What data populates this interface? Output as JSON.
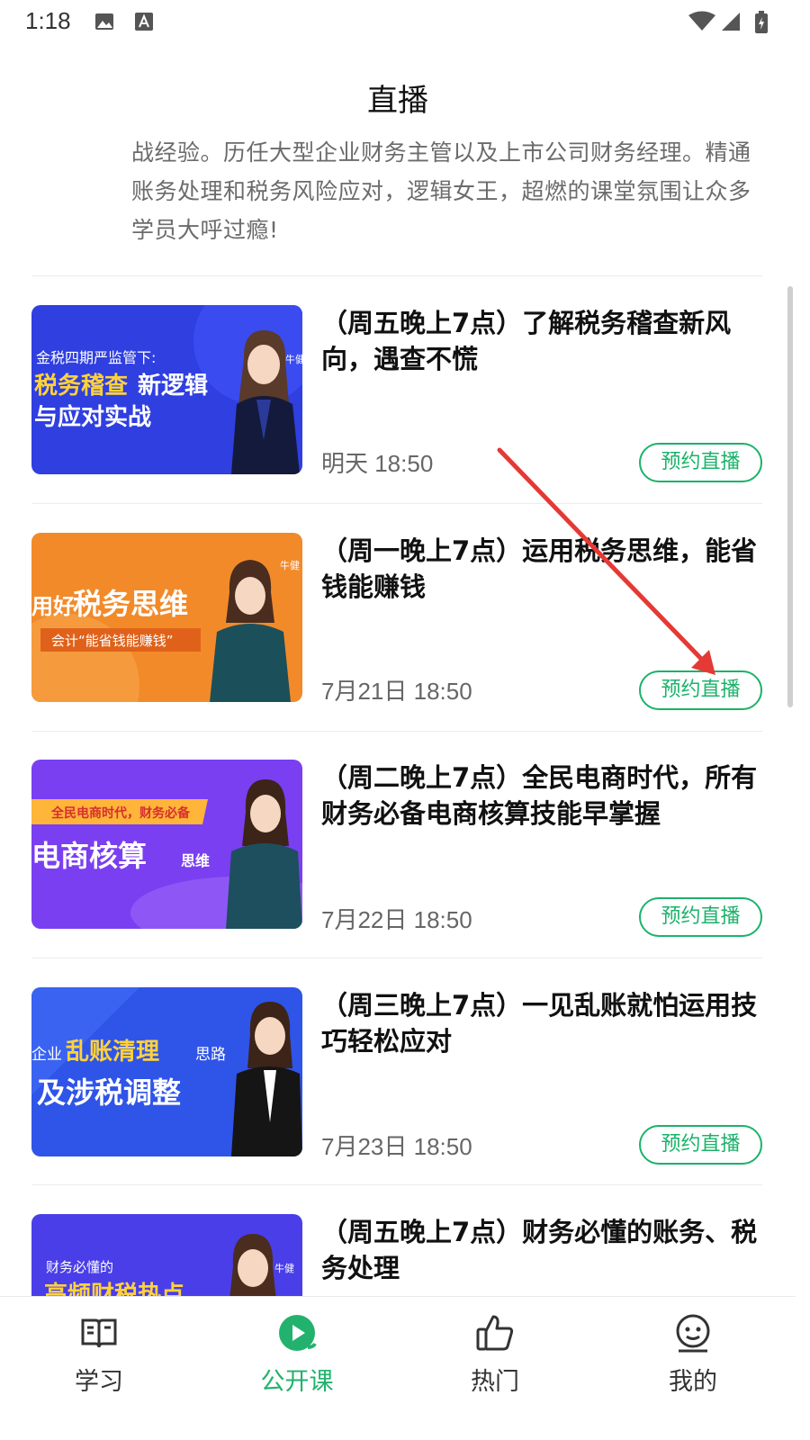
{
  "status": {
    "time": "1:18"
  },
  "header": {
    "title": "直播"
  },
  "intro": "战经验。历任大型企业财务主管以及上市公司财务经理。精通账务处理和税务风险应对，逻辑女王，超燃的课堂氛围让众多学员大呼过瘾!",
  "list": [
    {
      "title": "（周五晚上7点）了解税务稽查新风向，遇查不慌",
      "time": "明天 18:50",
      "button": "预约直播",
      "thumb": {
        "line1": "金税四期严监管下:",
        "line2a": "税务稽查",
        "line2b": "新逻辑",
        "line3": "与应对实战",
        "tag": "牛健",
        "bg": "#2f3fe0"
      }
    },
    {
      "title": "（周一晚上7点）运用税务思维，能省钱能赚钱",
      "time": "7月21日 18:50",
      "button": "预约直播",
      "thumb": {
        "line1a": "用好",
        "line1b": "税务思维",
        "line2": "会计“能省钱能赚钱”",
        "tag": "牛健",
        "bg": "#f28a2a"
      }
    },
    {
      "title": "（周二晚上7点）全民电商时代，所有财务必备电商核算技能早掌握",
      "time": "7月22日 18:50",
      "button": "预约直播",
      "thumb": {
        "line1": "全民电商时代，财务必备",
        "line2a": "电商核算",
        "line2b": "思维",
        "bg": "#7a3ff0"
      }
    },
    {
      "title": "（周三晚上7点）一见乱账就怕运用技巧轻松应对",
      "time": "7月23日 18:50",
      "button": "预约直播",
      "thumb": {
        "line1a": "企业",
        "line1b": "乱账清理",
        "line1c": "思路",
        "line2": "及涉税调整",
        "bg": "#2f54e8"
      }
    },
    {
      "title": "（周五晚上7点）财务必懂的账务、税务处理",
      "time": "",
      "button": "",
      "thumb": {
        "line1": "财务必懂的",
        "line2": "高频财税热点",
        "tag": "牛健",
        "bg": "#4a3ee8"
      }
    }
  ],
  "nav": [
    {
      "label": "学习",
      "icon": "book-icon"
    },
    {
      "label": "公开课",
      "icon": "play-circle-icon",
      "active": true
    },
    {
      "label": "热门",
      "icon": "thumbs-up-icon"
    },
    {
      "label": "我的",
      "icon": "user-face-icon"
    }
  ],
  "colors": {
    "accent": "#1bb26a",
    "annotation": "#e53935"
  }
}
